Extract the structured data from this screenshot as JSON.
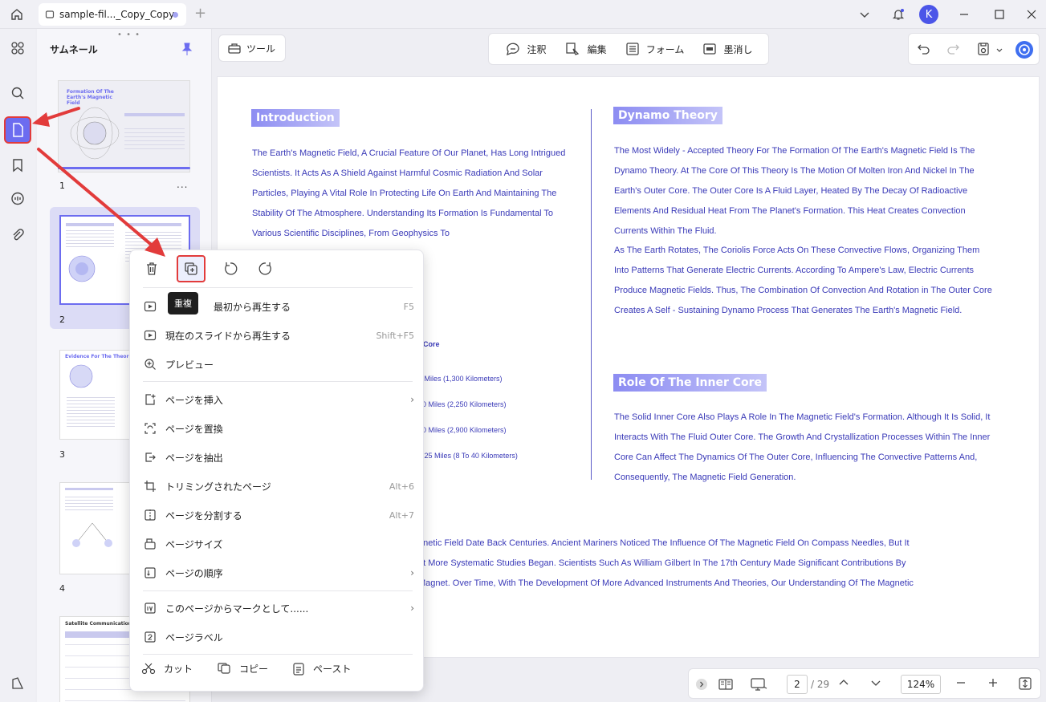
{
  "titlebar": {
    "tab_title": "sample-fil..._Copy_Copy",
    "add_tab": "+",
    "avatar_initial": "K"
  },
  "thumbnails": {
    "title": "サムネール",
    "pages": [
      {
        "num": "1",
        "heading": "Formation Of The Earth's Magnetic Field",
        "more": "..."
      },
      {
        "num": "2",
        "heading": ""
      },
      {
        "num": "3",
        "heading": "Evidence For The Theories"
      },
      {
        "num": "4",
        "heading": ""
      },
      {
        "num": "",
        "heading": "Satellite Communications And"
      }
    ]
  },
  "toolbar": {
    "tools_label": "ツール",
    "annotate_label": "注釈",
    "edit_label": "編集",
    "form_label": "フォーム",
    "redact_label": "墨消し"
  },
  "document": {
    "intro_title": "Introduction",
    "intro_text": "The Earth's Magnetic Field, A Crucial Feature Of Our Planet, Has Long Intrigued Scientists. It Acts As A Shield Against Harmful Cosmic Radiation And Solar Particles, Playing A Vital Role In Protecting Life On Earth And Maintaining The Stability Of The Atmosphere. Understanding Its Formation Is Fundamental To Various Scientific Disciplines, From Geophysics To",
    "dynamo_title": "Dynamo Theory",
    "dynamo_text_1": "The Most Widely - Accepted Theory For The Formation Of The Earth's Magnetic Field Is The Dynamo Theory. At The Core Of This Theory Is The Motion Of Molten Iron And Nickel In The Earth's Outer Core. The Outer Core Is A Fluid Layer, Heated By The Decay Of Radioactive Elements And Residual Heat From The Planet's Formation. This Heat Creates Convection Currents Within The Fluid.",
    "dynamo_text_2": "As The Earth Rotates, The Coriolis Force Acts On These Convective Flows, Organizing Them Into Patterns That Generate Electric Currents. According To Ampere's Law, Electric Currents Produce Magnetic Fields. Thus, The Combination Of Convection And Rotation in The Outer Core Creates A Self - Sustaining Dynamo Process That Generates The Earth's Magnetic Field.",
    "inner_title": "Role Of The Inner Core",
    "inner_text": "The Solid Inner Core Also Plays A Role In The Magnetic Field's Formation. Although It Is Solid, It Interacts With The Fluid Outer Core. The Growth And Crystallization Processes Within The Inner Core Can Affect The Dynamics Of The Outer Core, Influencing The Convective Patterns And, Consequently, The Magnetic Field Generation.",
    "frag_core": "r Core",
    "frag_1": "0 Miles (1,300 Kilometers)",
    "frag_2": "00 Miles (2,250 Kilometers)",
    "frag_3": "00 Miles (2,900 Kilometers)",
    "frag_4": "o 25 Miles (8 To 40 Kilometers)",
    "bottom_1": "gnetic Field Date Back Centuries. Ancient Mariners Noticed The Influence Of The Magnetic Field On Compass Needles, But It",
    "bottom_2": "at More Systematic Studies Began. Scientists Such As William Gilbert In The 17th Century Made Significant Contributions By",
    "bottom_3": "Magnet. Over Time, With The Development Of More Advanced Instruments And Theories, Our Understanding Of The Magnetic"
  },
  "context_menu": {
    "tooltip": "重複",
    "items": [
      {
        "label": "最初から再生する",
        "shortcut": "F5"
      },
      {
        "label": "現在のスライドから再生する",
        "shortcut": "Shift+F5"
      },
      {
        "label": "プレビュー",
        "shortcut": ""
      },
      {
        "label": "ページを挿入",
        "shortcut": "",
        "chevron": "›"
      },
      {
        "label": "ページを置換",
        "shortcut": ""
      },
      {
        "label": "ページを抽出",
        "shortcut": ""
      },
      {
        "label": "トリミングされたページ",
        "shortcut": "Alt+6"
      },
      {
        "label": "ページを分割する",
        "shortcut": "Alt+7"
      },
      {
        "label": "ページサイズ",
        "shortcut": ""
      },
      {
        "label": "ページの順序",
        "shortcut": "",
        "chevron": "›"
      },
      {
        "label": "このページからマークとして......",
        "shortcut": "",
        "chevron": "›"
      },
      {
        "label": "ページラベル",
        "shortcut": ""
      }
    ],
    "cut_label": "カット",
    "copy_label": "コピー",
    "paste_label": "ペースト"
  },
  "bottombar": {
    "current_page": "2",
    "total_pages": "/ 29",
    "zoom": "124%"
  },
  "colors": {
    "accent": "#6c6cf0",
    "highlight_red": "#e23b3b",
    "doc_text": "#3a3ab8"
  }
}
